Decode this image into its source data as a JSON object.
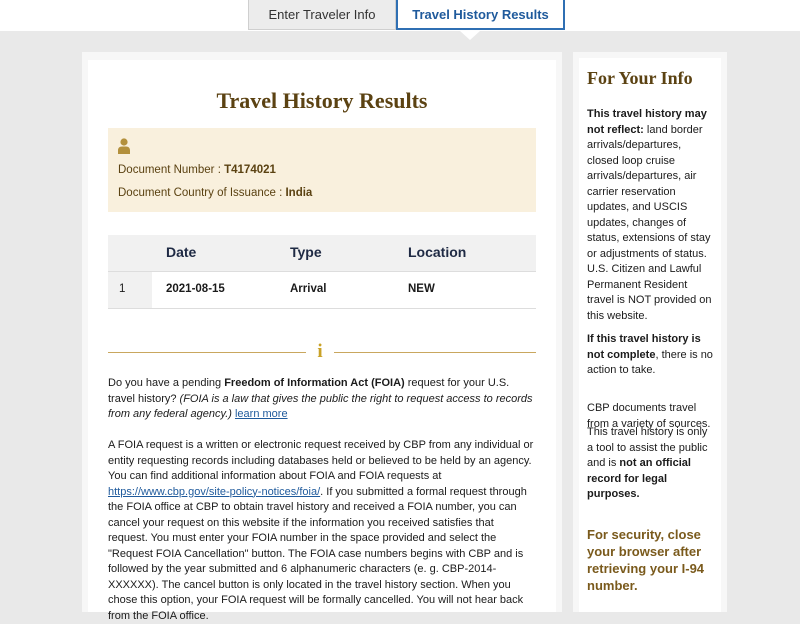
{
  "tabs": [
    {
      "label": "Enter Traveler Info",
      "active": false
    },
    {
      "label": "Travel History Results",
      "active": true
    }
  ],
  "main": {
    "heading": "Travel History Results",
    "document": {
      "icon": "person-icon",
      "number_label": "Document Number : ",
      "number_value": "T4174021",
      "country_label": "Document Country of Issuance : ",
      "country_value": "India"
    },
    "table": {
      "headers": [
        "",
        "Date",
        "Type",
        "Location"
      ],
      "rows": [
        {
          "index": "1",
          "date": "2021-08-15",
          "type": "Arrival",
          "location": "NEW"
        }
      ]
    },
    "info_icon": "info-icon",
    "info_glyph": "i",
    "foia_intro": {
      "pre": "Do you have a pending ",
      "bold": "Freedom of Information Act (FOIA)",
      "post": " request for your U.S. travel history? ",
      "italic": "(FOIA is a law that gives the public the right to request access to records from any federal agency.)",
      "link": "learn more"
    },
    "foia_body": {
      "part1": "A FOIA request is a written or electronic request received by CBP from any individual or entity requesting records including databases held or believed to be held by an agency. You can find additional information about FOIA and FOIA requests at ",
      "link": "https://www.cbp.gov/site-policy-notices/foia/",
      "part2": ". If you submitted a formal request through the FOIA office at CBP to obtain travel history and received a FOIA number, you can cancel your request on this website if the information you received satisfies that request. You must enter your FOIA number in the space provided and select the \"Request FOIA Cancellation\" button. The FOIA case numbers begins with CBP and is followed by the year submitted and 6 alphanumeric characters (e. g. CBP-2014-XXXXXX). The cancel button is only located in the travel history section. When you chose this option, your FOIA request will be formally cancelled. You will not hear back from the FOIA office."
    }
  },
  "sidebar": {
    "title": "For Your Info",
    "p1_bold": "This travel history may not reflect:",
    "p1_rest": " land border arrivals/departures, closed loop cruise arrivals/departures, air carrier reservation updates, and USCIS updates, changes of status, extensions of stay or adjustments of status. U.S. Citizen and Lawful Permanent Resident travel is NOT provided on this website.",
    "p2_bold": "If this travel history is not complete",
    "p2_rest": ", there is no action to take.",
    "p3": "CBP documents travel from a variety of sources.",
    "p4_pre": "This travel history is only a tool to assist the public and is ",
    "p4_bold": "not an official record for legal purposes.",
    "security": "For security, close your browser after retrieving your I-94 number."
  },
  "colors": {
    "brand_brown": "#5b4212",
    "doc_box": "#f9f0dd",
    "gold_rule": "#c9a75e",
    "link_blue": "#1f5a9c",
    "active_tab_border": "#2f6fb3"
  }
}
